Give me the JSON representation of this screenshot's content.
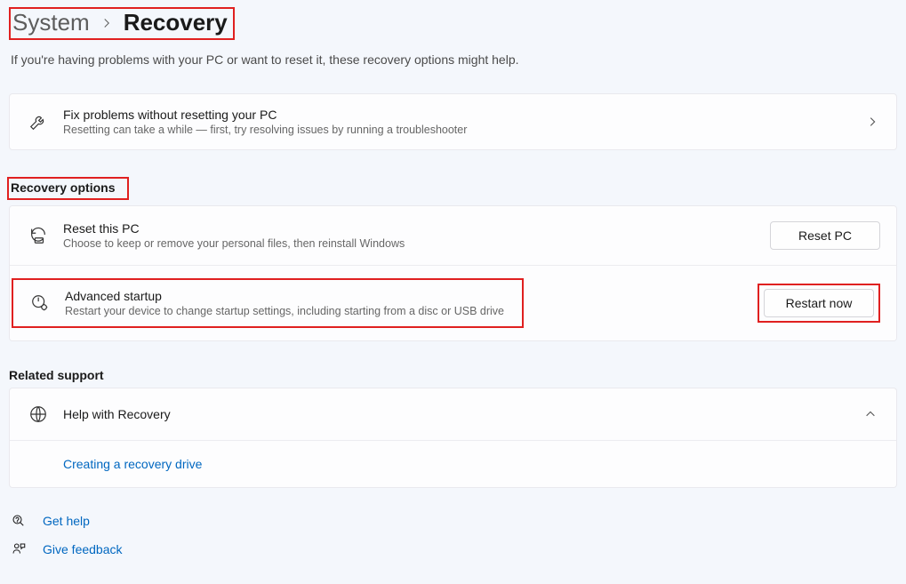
{
  "breadcrumb": {
    "parent": "System",
    "current": "Recovery"
  },
  "intro": "If you're having problems with your PC or want to reset it, these recovery options might help.",
  "fix_card": {
    "title": "Fix problems without resetting your PC",
    "subtitle": "Resetting can take a while — first, try resolving issues by running a troubleshooter"
  },
  "sections": {
    "recovery_heading": "Recovery options",
    "reset": {
      "title": "Reset this PC",
      "subtitle": "Choose to keep or remove your personal files, then reinstall Windows",
      "button": "Reset PC"
    },
    "advanced": {
      "title": "Advanced startup",
      "subtitle": "Restart your device to change startup settings, including starting from a disc or USB drive",
      "button": "Restart now"
    }
  },
  "related": {
    "heading": "Related support",
    "help_title": "Help with Recovery",
    "link": "Creating a recovery drive"
  },
  "footer": {
    "get_help": "Get help",
    "give_feedback": "Give feedback"
  }
}
